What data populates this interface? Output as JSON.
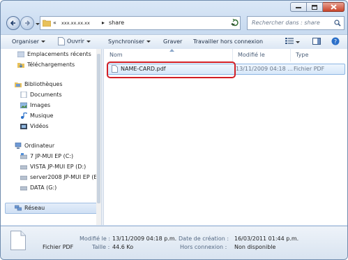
{
  "window": {
    "accent": "#c9452b",
    "frame": "#c9dbf0"
  },
  "address": {
    "chevron": "«",
    "path_root": "xxx.xx.xx.xx",
    "separator": "▸",
    "current": "share"
  },
  "search": {
    "placeholder": "Rechercher dans : share"
  },
  "toolbar": {
    "organize": "Organiser",
    "open": "Ouvrir",
    "sync": "Synchroniser",
    "burn": "Graver",
    "offline": "Travailler hors connexion"
  },
  "nav": {
    "favorites": [
      "Emplacements récents",
      "Téléchargements"
    ],
    "libraries_label": "Bibliothèques",
    "libraries": [
      "Documents",
      "Images",
      "Musique",
      "Vidéos"
    ],
    "computer_label": "Ordinateur",
    "drives": [
      "7 JP-MUI EP (C:)",
      "VISTA JP-MUI EP (D:)",
      "server2008 JP-MUI EP (E:)",
      "DATA (G:)"
    ],
    "network_label": "Réseau"
  },
  "columns": {
    "name": "Nom",
    "modified": "Modifié le",
    "type": "Type"
  },
  "files": [
    {
      "name": "NAME-CARD.pdf",
      "modified": "13/11/2009 04:18 ...",
      "type": "Fichier PDF"
    }
  ],
  "details": {
    "type": "Fichier PDF",
    "modified_label": "Modifié le :",
    "modified": "13/11/2009 04:18 p.m.",
    "size_label": "Taille :",
    "size": "44.6 Ko",
    "created_label": "Date de création :",
    "created": "16/03/2011 01:44 p.m.",
    "offline_label": "Hors connexion :",
    "offline": "Non disponible"
  }
}
